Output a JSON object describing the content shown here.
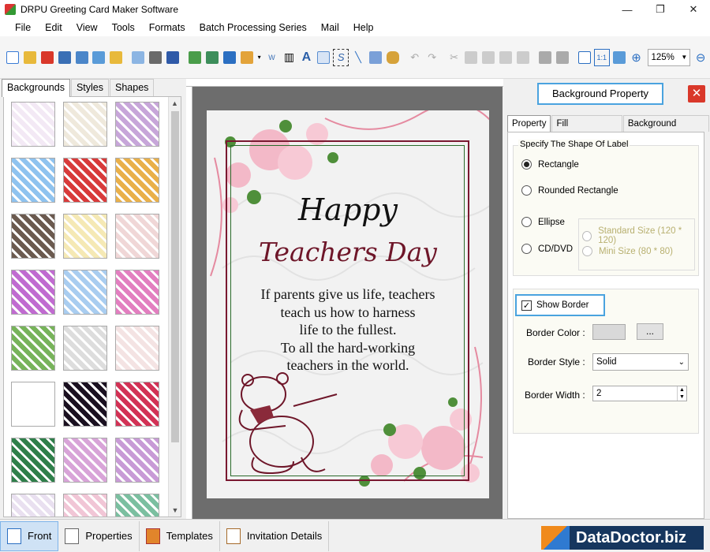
{
  "window": {
    "title": "DRPU Greeting Card Maker Software",
    "controls": [
      "—",
      "❐",
      "✕"
    ]
  },
  "menu": [
    "File",
    "Edit",
    "View",
    "Tools",
    "Formats",
    "Batch Processing Series",
    "Mail",
    "Help"
  ],
  "toolbar": {
    "zoom_value": "125%"
  },
  "left_panel": {
    "tabs": [
      "Backgrounds",
      "Styles",
      "Shapes"
    ],
    "active_tab": "Backgrounds",
    "thumbnails": [
      "#f3e9f5",
      "#efe9dc",
      "#c7a6d9",
      "#8fc3ef",
      "#d83b3b",
      "#e9b04a",
      "#6b5a4f",
      "#f5e9b5",
      "#f0d7d7",
      "#c06bd0",
      "#a9cdf0",
      "#e27fc0",
      "#77b35a",
      "#dddddd",
      "#f4e3e3",
      "#ffffff",
      "#1a1020",
      "#d23255",
      "#2f7f4a",
      "#d8a4d8",
      "#c89bd6",
      "#e9e0f0",
      "#f1c6d6",
      "#7bbfa0"
    ]
  },
  "card": {
    "line1": "Happy",
    "line2": "Teachers Day",
    "message": [
      "If parents give us life, teachers",
      "teach us how to harness",
      "life to the fullest.",
      "To all the hard-working",
      "teachers in the world."
    ]
  },
  "right_panel": {
    "title": "Background Property",
    "tabs": [
      "Property",
      "Fill Background",
      "Background Effects"
    ],
    "shape_group_label": "Specify The Shape Of Label",
    "shapes": [
      "Rectangle",
      "Rounded Rectangle",
      "Ellipse",
      "CD/DVD"
    ],
    "selected_shape": "Rectangle",
    "sizes": [
      "Standard Size (120 * 120)",
      "Mini Size (80 * 80)"
    ],
    "show_border_label": "Show Border",
    "show_border_checked": true,
    "border_color_label": "Border Color :",
    "border_color_btn": "...",
    "border_style_label": "Border Style :",
    "border_style_value": "Solid",
    "border_width_label": "Border Width :",
    "border_width_value": "2"
  },
  "bottom_bar": {
    "tabs": [
      "Front",
      "Properties",
      "Templates",
      "Invitation Details"
    ],
    "active_tab": "Front",
    "brand": "DataDoctor.biz"
  }
}
